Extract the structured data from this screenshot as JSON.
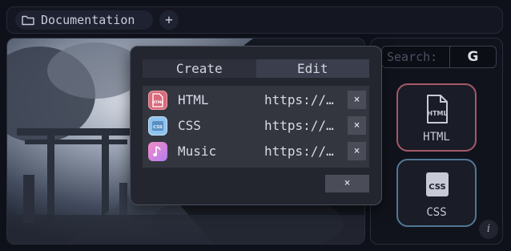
{
  "topbar": {
    "folder_icon": "folder-icon",
    "folder_label": "Documentation",
    "add_label": "+"
  },
  "search": {
    "placeholder": "Search:",
    "engine_label": "G"
  },
  "shortcuts": [
    {
      "label": "HTML",
      "icon": "html-file-icon",
      "accent": "#a45a68"
    },
    {
      "label": "CSS",
      "icon": "css-file-icon",
      "accent": "#4f7893"
    }
  ],
  "info_label": "i",
  "modal": {
    "tabs": [
      {
        "label": "Create",
        "active": false
      },
      {
        "label": "Edit",
        "active": true
      }
    ],
    "links": [
      {
        "name": "HTML",
        "url": "https://…",
        "icon": "html-icon",
        "remove_label": "×"
      },
      {
        "name": "CSS",
        "url": "https://…",
        "icon": "css-icon",
        "remove_label": "×"
      },
      {
        "name": "Music",
        "url": "https://…",
        "icon": "music-note-icon",
        "remove_label": "×"
      }
    ],
    "close_label": "×"
  }
}
